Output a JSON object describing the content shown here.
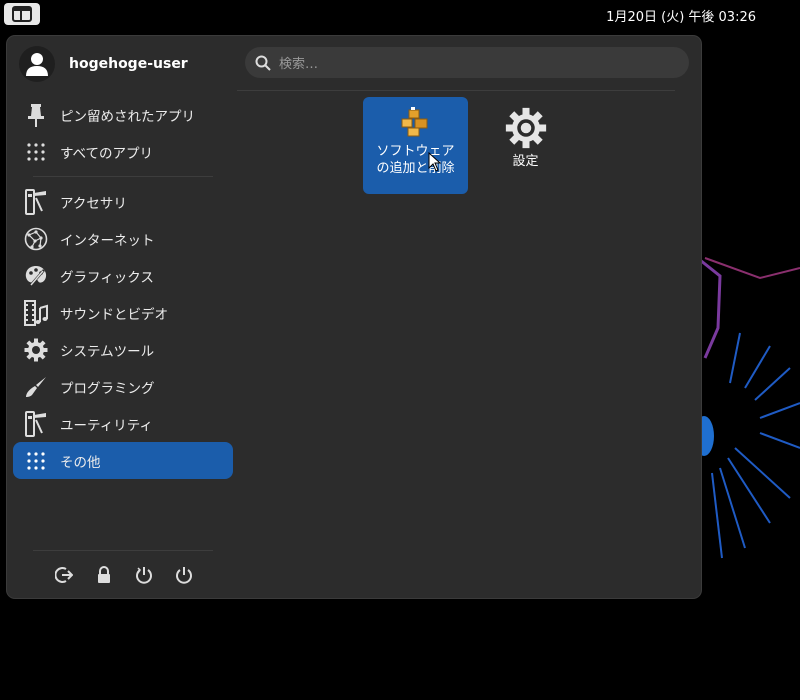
{
  "topbar": {
    "clock": "1月20日 (火) 午後 03:26"
  },
  "user": {
    "name": "hogehoge-user"
  },
  "search": {
    "placeholder": "検索…"
  },
  "sidebar": {
    "top_items": [
      {
        "label": "ピン留めされたアプリ",
        "icon": "pin-icon"
      },
      {
        "label": "すべてのアプリ",
        "icon": "app-grid-icon"
      }
    ],
    "categories": [
      {
        "label": "アクセサリ",
        "icon": "accessories-icon"
      },
      {
        "label": "インターネット",
        "icon": "internet-icon"
      },
      {
        "label": "グラフィックス",
        "icon": "graphics-icon"
      },
      {
        "label": "サウンドとビデオ",
        "icon": "multimedia-icon"
      },
      {
        "label": "システムツール",
        "icon": "system-tools-icon"
      },
      {
        "label": "プログラミング",
        "icon": "programming-icon"
      },
      {
        "label": "ユーティリティ",
        "icon": "utilities-icon"
      },
      {
        "label": "その他",
        "icon": "other-icon",
        "active": true
      }
    ]
  },
  "session_actions": [
    "logout-icon",
    "lock-icon",
    "restart-icon",
    "power-icon"
  ],
  "apps": [
    {
      "label": "ソフトウェアの追加と削除",
      "line1": "ソフトウェア",
      "line2": "の追加と削除",
      "icon": "software-packages-icon",
      "selected": true
    },
    {
      "label": "設定",
      "icon": "settings-gear-icon",
      "selected": false
    }
  ],
  "colors": {
    "accent": "#1b5dab",
    "panel": "#2c2c2c"
  }
}
